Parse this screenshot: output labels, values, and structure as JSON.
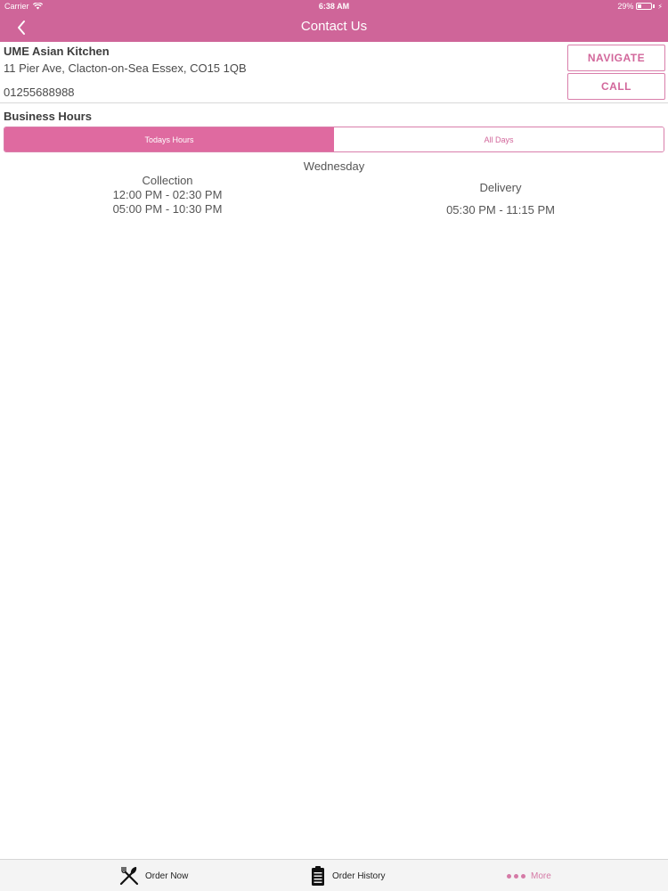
{
  "status_bar": {
    "carrier": "Carrier",
    "time": "6:38 AM",
    "battery": "29%",
    "battery_level": 0.29
  },
  "nav": {
    "title": "Contact Us"
  },
  "business": {
    "name": "UME Asian Kitchen",
    "address": "11 Pier Ave, Clacton-on-Sea Essex, CO15 1QB",
    "phone": "01255688988"
  },
  "actions": {
    "navigate_label": "NAVIGATE",
    "call_label": "CALL"
  },
  "hours": {
    "heading": "Business Hours",
    "tabs": [
      {
        "label": "Todays Hours",
        "active": true
      },
      {
        "label": "All Days",
        "active": false
      }
    ],
    "day": "Wednesday",
    "collection": {
      "label": "Collection",
      "slots": [
        "12:00 PM - 02:30 PM",
        "05:00 PM - 10:30 PM"
      ]
    },
    "delivery": {
      "label": "Delivery",
      "slots": [
        "05:30 PM - 11:15 PM"
      ]
    }
  },
  "tab_bar": {
    "items": [
      {
        "label": "Order Now",
        "icon": "fork-knife-icon"
      },
      {
        "label": "Order History",
        "icon": "clipboard-icon"
      },
      {
        "label": "More",
        "icon": "more-dots-icon"
      }
    ]
  },
  "colors": {
    "accent": "#cf6599",
    "accent_light": "#df6aa0",
    "more_tint": "#d57aa6"
  }
}
